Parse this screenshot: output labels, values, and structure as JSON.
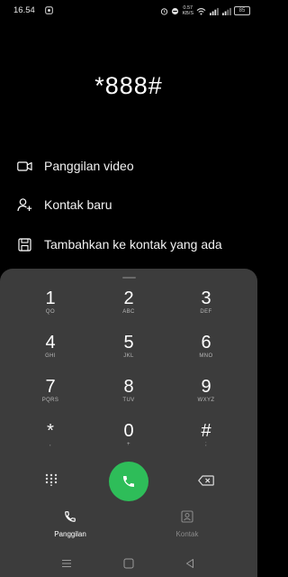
{
  "status_bar": {
    "time": "16.54",
    "net_speed_value": "0.57",
    "net_speed_unit": "KB/S",
    "battery": "85"
  },
  "dialed_number": "*888#",
  "actions": [
    {
      "label": "Panggilan video",
      "icon": "video-camera-icon"
    },
    {
      "label": "Kontak baru",
      "icon": "add-person-icon"
    },
    {
      "label": "Tambahkan ke kontak yang ada",
      "icon": "save-icon"
    }
  ],
  "keypad": [
    {
      "digit": "1",
      "letters": "QO"
    },
    {
      "digit": "2",
      "letters": "ABC"
    },
    {
      "digit": "3",
      "letters": "DEF"
    },
    {
      "digit": "4",
      "letters": "GHI"
    },
    {
      "digit": "5",
      "letters": "JKL"
    },
    {
      "digit": "6",
      "letters": "MNO"
    },
    {
      "digit": "7",
      "letters": "PQRS"
    },
    {
      "digit": "8",
      "letters": "TUV"
    },
    {
      "digit": "9",
      "letters": "WXYZ"
    },
    {
      "digit": "*",
      "letters": ","
    },
    {
      "digit": "0",
      "letters": "+"
    },
    {
      "digit": "#",
      "letters": ";"
    }
  ],
  "tabs": [
    {
      "label": "Panggilan",
      "active": true
    },
    {
      "label": "Kontak",
      "active": false
    }
  ],
  "colors": {
    "call_button": "#2ebd59",
    "pad_background": "#3c3c3c",
    "inactive_tab": "#8a8a8a"
  }
}
